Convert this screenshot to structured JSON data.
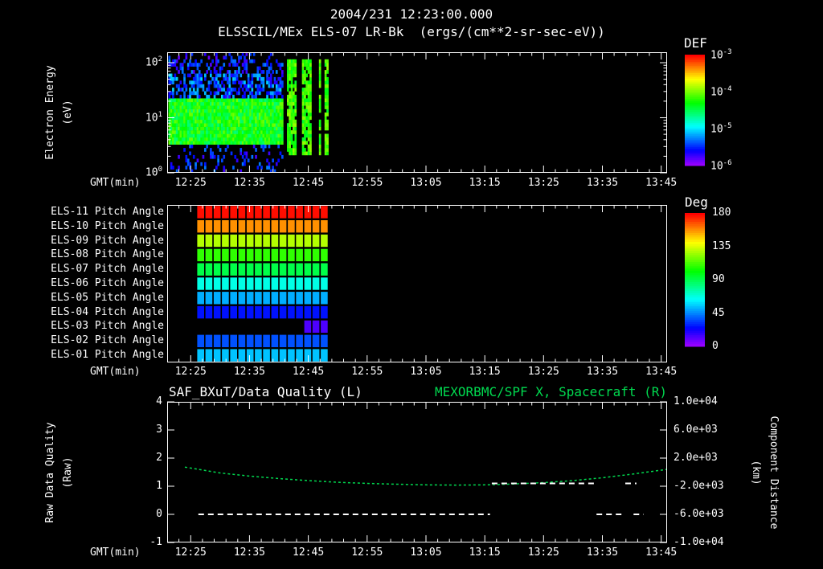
{
  "colors": {
    "background": "#000000",
    "foreground": "#ffffff",
    "green": "#00d94f"
  },
  "header": {
    "timestamp": "2004/231 12:23:00.000",
    "instrument_title": "ELSSCIL/MEx ELS-07 LR-Bk  (ergs/(cm**2-sr-sec-eV))"
  },
  "time_axis": {
    "label": "GMT(min)",
    "tick_labels": [
      "12:25",
      "12:35",
      "12:45",
      "12:55",
      "13:05",
      "13:15",
      "13:25",
      "13:35",
      "13:45"
    ],
    "tick_minutes": [
      5,
      15,
      25,
      35,
      45,
      55,
      65,
      75,
      85
    ],
    "domain_minutes": [
      1,
      86
    ],
    "origin_time": "12:20"
  },
  "chart_data": [
    {
      "type": "heatmap",
      "name": "electron-energy-spectrogram",
      "ylabel_line1": "Electron Energy",
      "ylabel_line2": "(eV)",
      "yscale": "log",
      "ylim_ev": [
        1,
        155
      ],
      "ytick_exponents": [
        2,
        1,
        0
      ],
      "colorbar": {
        "title": "DEF",
        "units": "ergs/(cm**2-sr-sec-eV)",
        "tick_exponents": [
          -3,
          -4,
          -5,
          -6
        ],
        "log10_range": [
          -6,
          -3
        ]
      },
      "coverage_minutes": [
        1.2,
        28.4
      ],
      "features": {
        "nominal_region_end_minute": 20.7,
        "low_energy_band": {
          "energy_ev": [
            3.5,
            22
          ],
          "log10_flux": -4.3
        },
        "speckle_field": {
          "energy_ev": [
            22,
            150
          ],
          "log10_flux": -5.35
        },
        "data_gap_minutes": [
          [
            20.7,
            21.5
          ],
          [
            22.9,
            24.0
          ],
          [
            25.6,
            26.7
          ],
          [
            27.2,
            27.8
          ]
        ],
        "bright_column_minutes": [
          [
            21.5,
            22.9
          ],
          [
            24.0,
            25.6
          ],
          [
            26.7,
            27.2
          ],
          [
            27.8,
            28.4
          ]
        ],
        "bright_column_log10_flux": -4.15
      }
    },
    {
      "type": "heatmap",
      "name": "pitch-angle-rows",
      "coverage_minutes": [
        6,
        28.4
      ],
      "cell_minutes": 1.4,
      "colorbar": {
        "title": "Deg",
        "ticks": [
          180,
          135,
          90,
          45,
          0
        ],
        "range_deg": [
          0,
          180
        ]
      },
      "rows": [
        {
          "label": "ELS-11 Pitch Angle",
          "pitch_deg": 178
        },
        {
          "label": "ELS-10 Pitch Angle",
          "pitch_deg": 158
        },
        {
          "label": "ELS-09 Pitch Angle",
          "pitch_deg": 130
        },
        {
          "label": "ELS-08 Pitch Angle",
          "pitch_deg": 110
        },
        {
          "label": "ELS-07 Pitch Angle",
          "pitch_deg": 92
        },
        {
          "label": "ELS-06 Pitch Angle",
          "pitch_deg": 68
        },
        {
          "label": "ELS-05 Pitch Angle",
          "pitch_deg": 52
        },
        {
          "label": "ELS-04 Pitch Angle",
          "pitch_deg": 28
        },
        {
          "label": "ELS-03 Pitch Angle",
          "pitch_deg": 14,
          "coverage_minutes": [
            23.5,
            28.4
          ]
        },
        {
          "label": "ELS-02 Pitch Angle",
          "pitch_deg": 38
        },
        {
          "label": "ELS-01 Pitch Angle",
          "pitch_deg": 55
        }
      ]
    },
    {
      "type": "line",
      "name": "quality-and-distance",
      "title_left": "SAF_BXuT/Data Quality (L)",
      "title_right": "MEXORBMC/SPF X, Spacecraft (R)",
      "ylabel_left_line1": "Raw Data Quality",
      "ylabel_left_line2": "(Raw)",
      "ylabel_right_line1": "Component Distance",
      "ylabel_right_line2": "(km)",
      "ylim_left": [
        -1,
        4
      ],
      "yticks_left": [
        4,
        3,
        2,
        1,
        0,
        -1
      ],
      "ylim_right": [
        -10000,
        10000
      ],
      "ytick_labels_right": [
        "1.0e+04",
        "6.0e+03",
        "2.0e+03",
        "-2.0e+03",
        "-6.0e+03",
        "-1.0e+04"
      ],
      "spacecraft_x": {
        "legend": "MEXORBMC/SPF X, Spacecraft",
        "style": "dashed-green",
        "x_minutes": [
          4,
          10,
          15,
          20,
          25,
          30,
          35,
          40,
          45,
          50,
          55,
          60,
          65,
          70,
          75,
          80,
          86
        ],
        "values_km": [
          720,
          -120,
          -560,
          -920,
          -1200,
          -1440,
          -1600,
          -1720,
          -1800,
          -1840,
          -1800,
          -1680,
          -1480,
          -1200,
          -800,
          -280,
          400
        ]
      },
      "quality_segments": [
        {
          "value": 0,
          "t_minutes": [
            6.3,
            55.9
          ]
        },
        {
          "value": 1.1,
          "t_minutes": [
            56.2,
            73.7
          ]
        },
        {
          "value": 0,
          "t_minutes": [
            74.0,
            78.3
          ]
        },
        {
          "value": 1.1,
          "t_minutes": [
            78.9,
            80.8
          ]
        },
        {
          "value": 0,
          "t_minutes": [
            80.3,
            82.0
          ]
        }
      ]
    }
  ]
}
